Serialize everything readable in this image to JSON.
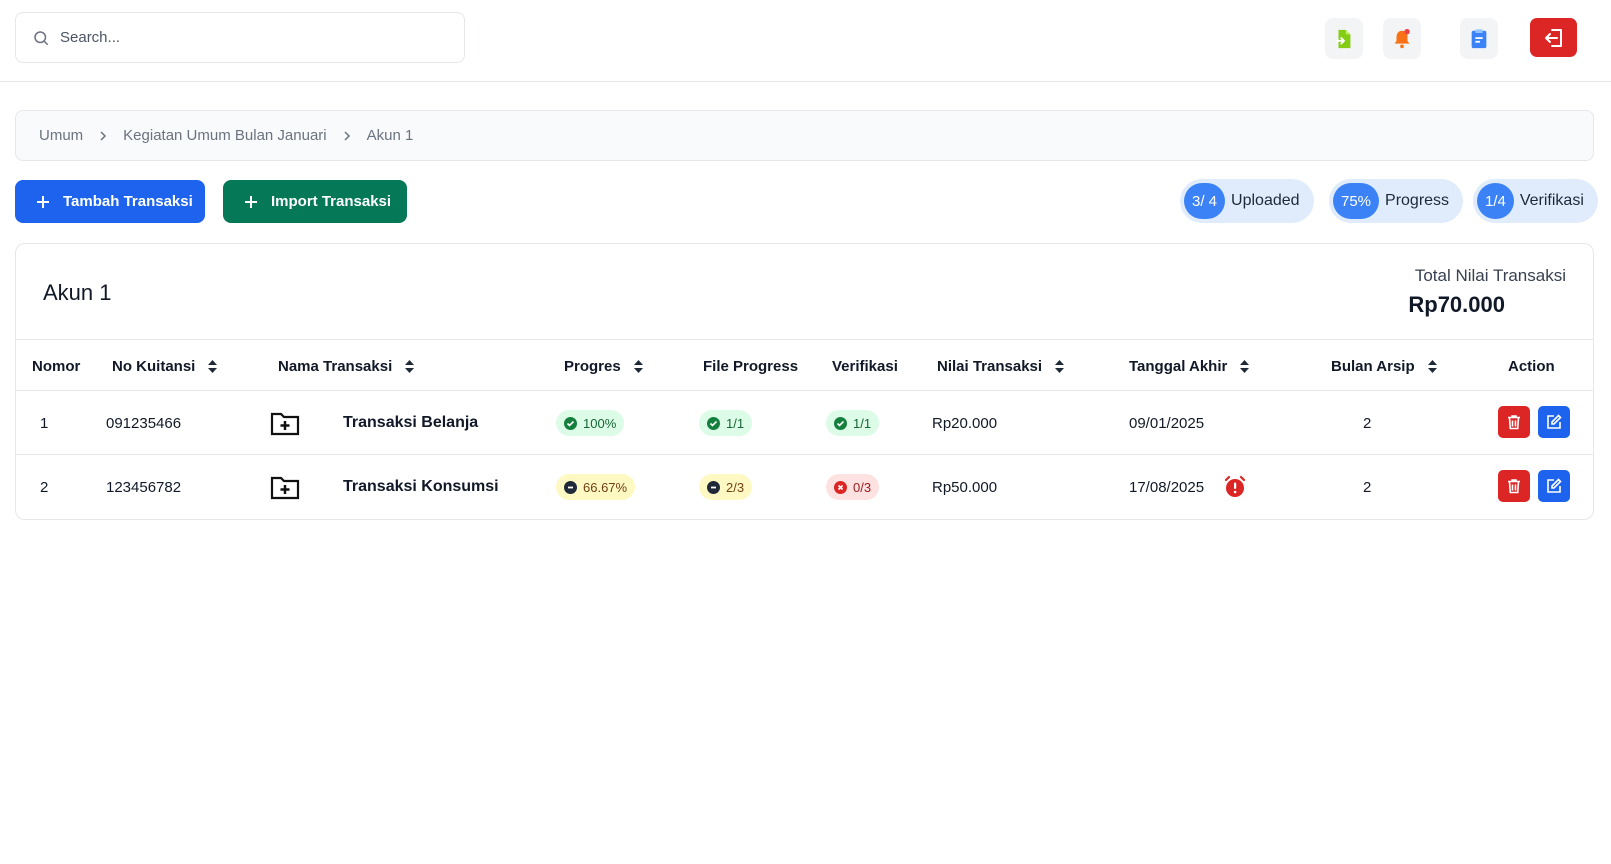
{
  "search": {
    "placeholder": "Search..."
  },
  "topbar": {
    "icons": [
      "file-import-icon",
      "bell-icon",
      "clipboard-icon",
      "logout-icon"
    ],
    "colors": {
      "import": "#84cc16",
      "bell": "#f97316",
      "bell_dot": "#ef4444",
      "clipboard": "#3b82f6",
      "logout_bg": "#dc2626"
    }
  },
  "breadcrumb": [
    "Umum",
    "Kegiatan Umum Bulan Januari",
    "Akun 1"
  ],
  "actions": {
    "tambah_label": "Tambah Transaksi",
    "import_label": "Import Transaksi"
  },
  "stats": {
    "uploaded": {
      "value": "3/ 4",
      "label": "Uploaded"
    },
    "progress": {
      "value": "75%",
      "label": "Progress"
    },
    "verifikasi": {
      "value": "1/4",
      "label": "Verifikasi"
    }
  },
  "card": {
    "title": "Akun 1",
    "total_label": "Total Nilai Transaksi",
    "total_value": "Rp70.000"
  },
  "table": {
    "columns": [
      "Nomor",
      "No Kuitansi",
      "Nama Transaksi",
      "Progres",
      "File Progress",
      "Verifikasi",
      "Nilai Transaksi",
      "Tanggal Akhir",
      "Bulan Arsip",
      "Action"
    ],
    "rows": [
      {
        "nomor": "1",
        "kuitansi": "091235466",
        "nama": "Transaksi Belanja",
        "progres": "100%",
        "progres_status": "green",
        "file": "1/1",
        "file_status": "green",
        "verifikasi": "1/1",
        "verifikasi_status": "green",
        "nilai": "Rp20.000",
        "tanggal": "09/01/2025",
        "alarm": false,
        "bulan": "2"
      },
      {
        "nomor": "2",
        "kuitansi": "123456782",
        "nama": "Transaksi Konsumsi",
        "progres": "66.67%",
        "progres_status": "yellow",
        "file": "2/3",
        "file_status": "yellow",
        "verifikasi": "0/3",
        "verifikasi_status": "red",
        "nilai": "Rp50.000",
        "tanggal": "17/08/2025",
        "alarm": true,
        "bulan": "2"
      }
    ]
  },
  "colors": {
    "primary": "#1d63ed",
    "import_btn": "#047857",
    "danger": "#dc2626",
    "pill_bg": "#e0ecfb",
    "pill_accent": "#3b82f6"
  }
}
